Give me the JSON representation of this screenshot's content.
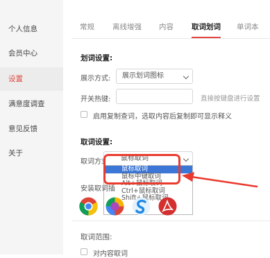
{
  "sidebar": {
    "items": [
      {
        "label": "个人信息"
      },
      {
        "label": "会员中心"
      },
      {
        "label": "设置"
      },
      {
        "label": "满意度调查"
      },
      {
        "label": "意见反馈"
      },
      {
        "label": "关于"
      }
    ],
    "active_index": 2
  },
  "tabs": [
    {
      "label": "常规"
    },
    {
      "label": "离线增强"
    },
    {
      "label": "内容"
    },
    {
      "label": "取词划词"
    },
    {
      "label": "单词本"
    }
  ],
  "active_tab": "取词划词",
  "highlight": {
    "section_title": "划词设置:",
    "display_label": "展示方式:",
    "display_value": "展示划词图标",
    "hotkey_label": "开关热键:",
    "hotkey_value": "",
    "hotkey_hint": "直接按键盘进行设置",
    "copy_lookup_label": "启用复制查词，选取内容后复制即可显示释义",
    "copy_lookup_checked": false
  },
  "lookup": {
    "section_title": "取词设置:",
    "method_label": "取词方式:",
    "method_value": "鼠标取词",
    "browser_label": "安装取词插",
    "options": [
      {
        "label": "鼠标取词",
        "selected": true
      },
      {
        "label": "鼠标中键取词",
        "selected": false
      },
      {
        "label": "Alt+鼠标取词",
        "selected": false
      },
      {
        "label": "Ctrl+鼠标取词",
        "selected": false
      },
      {
        "label": "Shift+鼠标取词",
        "selected": false
      }
    ]
  },
  "browsers": [
    {
      "icon": "chrome-icon",
      "color": "#4285f4"
    },
    {
      "icon": "chromium-colorful-icon",
      "color": "#f4b400"
    },
    {
      "icon": "sogou-browser-icon",
      "color": "#1e88e5"
    },
    {
      "icon": "acrobat-icon",
      "color": "#d32f2f"
    }
  ],
  "scope": {
    "section_title": "取词范围:",
    "first_option_label": "对内容取词"
  },
  "colors": {
    "accent": "#e0473f",
    "annotation": "#ea3a2e",
    "selection": "#3c76d6"
  }
}
